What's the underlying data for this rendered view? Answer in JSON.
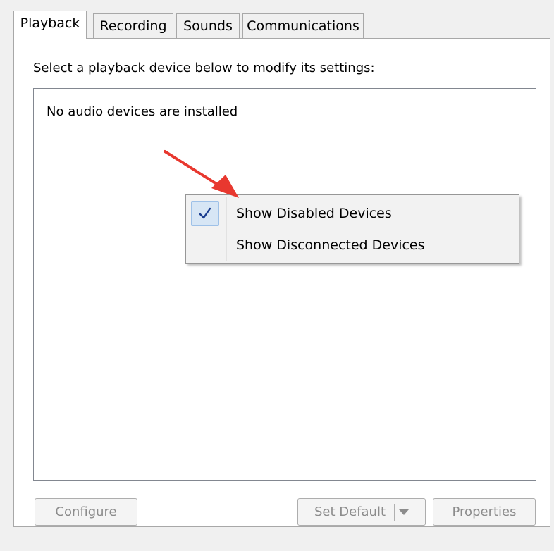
{
  "tabs": [
    {
      "label": "Playback",
      "active": true
    },
    {
      "label": "Recording",
      "active": false
    },
    {
      "label": "Sounds",
      "active": false
    },
    {
      "label": "Communications",
      "active": false
    }
  ],
  "instruction": "Select a playback device below to modify its settings:",
  "device_list": {
    "empty_message": "No audio devices are installed"
  },
  "context_menu": {
    "items": [
      {
        "label": "Show Disabled Devices",
        "checked": true
      },
      {
        "label": "Show Disconnected Devices",
        "checked": false
      }
    ]
  },
  "buttons": {
    "configure": "Configure",
    "set_default": "Set Default",
    "properties": "Properties"
  },
  "colors": {
    "annotation_arrow": "#e8382f",
    "check_mark": "#1a3d8f",
    "disabled_text": "#8c8c8c"
  }
}
